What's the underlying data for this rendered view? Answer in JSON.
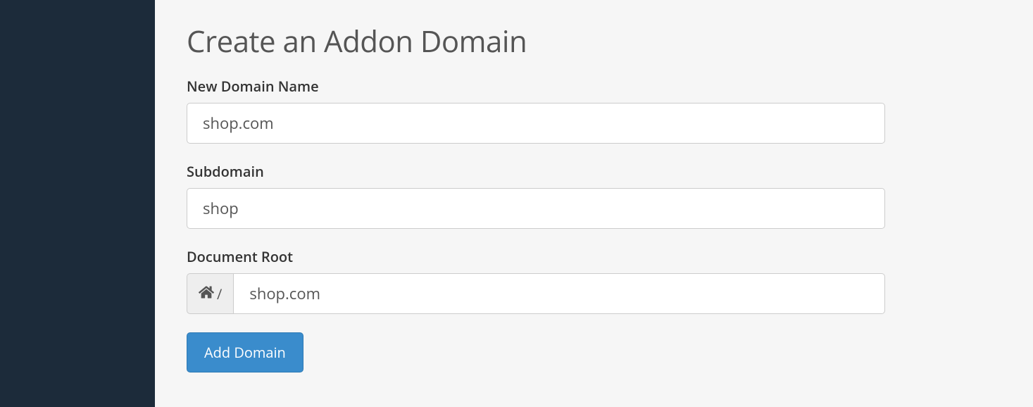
{
  "page": {
    "title": "Create an Addon Domain"
  },
  "form": {
    "domain": {
      "label": "New Domain Name",
      "value": "shop.com"
    },
    "subdomain": {
      "label": "Subdomain",
      "value": "shop"
    },
    "docroot": {
      "label": "Document Root",
      "prefix_separator": "/",
      "value": "shop.com"
    },
    "submit_label": "Add Domain"
  }
}
